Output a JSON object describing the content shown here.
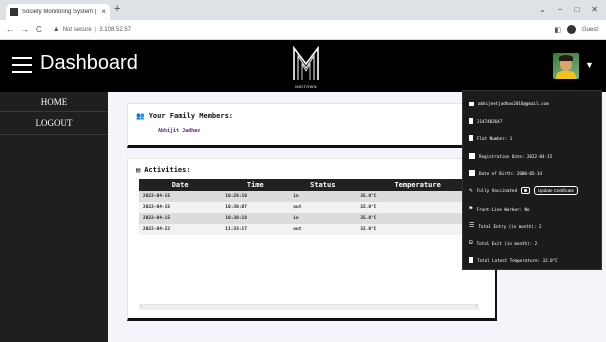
{
  "browser": {
    "tab_title": "Society Monitoring System | Da",
    "tab_close": "×",
    "new_tab": "+",
    "address": {
      "security": "Not secure",
      "url": "3.108.52.57"
    },
    "profile_label": "Guest"
  },
  "header": {
    "title": "Dashboard",
    "logo_text": "MIDTOWN"
  },
  "sidebar": {
    "items": [
      {
        "label": "HOME"
      },
      {
        "label": "LOGOUT"
      }
    ]
  },
  "family": {
    "title": "Your Family Members:",
    "members": [
      "Abhijit Jadhav"
    ]
  },
  "activities": {
    "title": "Activities:",
    "columns": [
      "Date",
      "Time",
      "Status",
      "Temperature"
    ],
    "rows": [
      [
        "2022-04-15",
        "10:28:10",
        "in",
        "35.0°C"
      ],
      [
        "2022-04-15",
        "10:30:07",
        "out",
        "32.0°C"
      ],
      [
        "2022-04-15",
        "10:30:18",
        "in",
        "35.0°C"
      ],
      [
        "2022-04-22",
        "11:33:17",
        "out",
        "32.0°C"
      ]
    ]
  },
  "profile": {
    "email": "abhijeetjadhav2016@gmail.com",
    "phone": "2147483647",
    "flat": "Flat Number: 1",
    "registration": "Registration Date: 2022-04-15",
    "dob": "Date of Birth: 2000-05-14",
    "vaccination": "Fully Vaccinated",
    "update_button": "Update Certificate",
    "frontline": "Front-Line Worker: No",
    "entries": "Total Entry (in month): 2",
    "exits": "Total Exit (in month): 2",
    "temperature": "Total Latest Temperature: 32.0°C"
  }
}
